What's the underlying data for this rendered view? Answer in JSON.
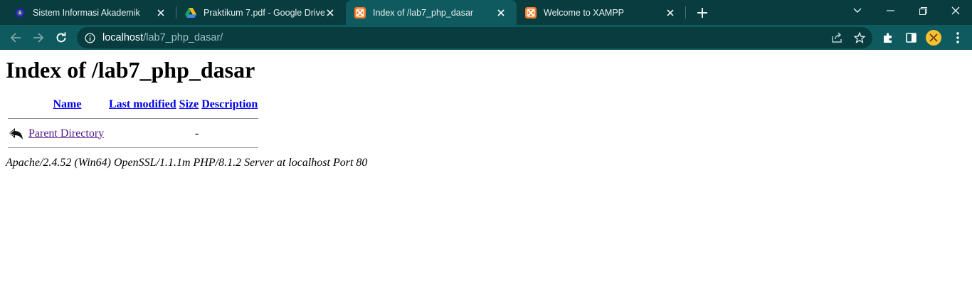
{
  "browser": {
    "tabs": [
      {
        "title": "Sistem Informasi Akademik",
        "favicon": "university-seal-icon"
      },
      {
        "title": "Praktikum 7.pdf - Google Drive",
        "favicon": "google-drive-icon"
      },
      {
        "title": "Index of /lab7_php_dasar",
        "favicon": "xampp-icon",
        "active": true
      },
      {
        "title": "Welcome to XAMPP",
        "favicon": "xampp-icon"
      }
    ],
    "address": {
      "host": "localhost",
      "path": "/lab7_php_dasar/"
    },
    "colors": {
      "tab_strip": "#083c3f",
      "toolbar": "#0f5a5e",
      "omnibox": "#083c3f",
      "xampp": "#fb7a24"
    }
  },
  "page": {
    "heading": "Index of /lab7_php_dasar",
    "columns": {
      "name": "Name",
      "last_modified": "Last modified",
      "size": "Size",
      "description": "Description"
    },
    "rows": [
      {
        "icon": "back-arrow-icon",
        "name": "Parent Directory",
        "last_modified": "",
        "size": "-",
        "description": ""
      }
    ],
    "server_signature": "Apache/2.4.52 (Win64) OpenSSL/1.1.1m PHP/8.1.2 Server at localhost Port 80"
  }
}
